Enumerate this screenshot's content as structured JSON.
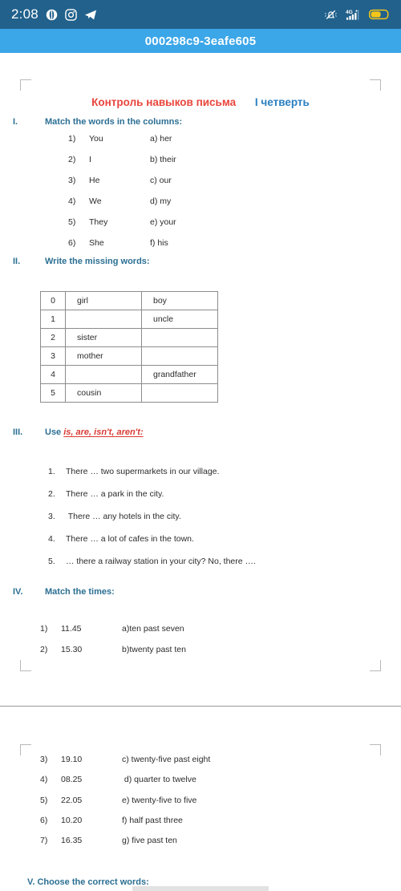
{
  "statusbar": {
    "time": "2:08",
    "left_icons": [
      "opera-browser-icon",
      "instagram-icon",
      "telegram-icon"
    ],
    "right_icons": [
      "bell-muted-icon",
      "signal-4g-plus-icon",
      "battery-icon"
    ],
    "background_color": "#21618c",
    "battery_color": "#f5c518"
  },
  "titlebar": {
    "title": "000298c9-3eafe605",
    "background_color": "#3ba6e8"
  },
  "document": {
    "heading_ru": "Контроль навыков письма",
    "heading_quarter": "I четверть",
    "heading_ru_color": "#e8453c",
    "heading_quarter_color": "#2a7fc1",
    "section_color": "#2b6f93",
    "sections": [
      {
        "num": "I.",
        "title": "Match the words in the columns:",
        "pairs": [
          {
            "n": "1)",
            "left": "You",
            "right": "a) her"
          },
          {
            "n": "2)",
            "left": "I",
            "right": "b) their"
          },
          {
            "n": "3)",
            "left": "He",
            "right": "c) our"
          },
          {
            "n": "4)",
            "left": "We",
            "right": "d) my"
          },
          {
            "n": "5)",
            "left": "They",
            "right": "e) your"
          },
          {
            "n": "6)",
            "left": "She",
            "right": "f) his"
          }
        ]
      },
      {
        "num": "II.",
        "title": "Write the missing  words:",
        "table": {
          "rows": [
            {
              "idx": "0",
              "c1": "girl",
              "c2": "boy"
            },
            {
              "idx": "1",
              "c1": "",
              "c2": "uncle"
            },
            {
              "idx": "2",
              "c1": "sister",
              "c2": ""
            },
            {
              "idx": "3",
              "c1": "mother",
              "c2": ""
            },
            {
              "idx": "4",
              "c1": "",
              "c2": "grandfather"
            },
            {
              "idx": "5",
              "c1": "cousin",
              "c2": ""
            }
          ]
        }
      },
      {
        "num": "III.",
        "title_plain": "Use ",
        "title_emph": "is, are, isn't, aren't:",
        "questions": [
          {
            "n": "1.",
            "text": "There … two supermarkets in our village."
          },
          {
            "n": "2.",
            "text": "There … a park in the city."
          },
          {
            "n": "3.",
            "text": " There …  any hotels in the city."
          },
          {
            "n": "4.",
            "text": "There … a lot of cafes in the town."
          },
          {
            "n": "5.",
            "text": "… there a railway station in your city? No, there …."
          }
        ]
      },
      {
        "num": "IV.",
        "title": "Match the times:",
        "pairs_top": [
          {
            "n": "1)",
            "left": "11.45",
            "right": "a)ten past seven"
          },
          {
            "n": "2)",
            "left": "15.30",
            "right": "b)twenty past ten"
          }
        ],
        "pairs_bottom": [
          {
            "n": "3)",
            "left": "19.10",
            "right": "c) twenty-five past eight"
          },
          {
            "n": "4)",
            "left": "08.25",
            "right": " d) quarter to twelve"
          },
          {
            "n": "5)",
            "left": "22.05",
            "right": "e) twenty-five to five"
          },
          {
            "n": "6)",
            "left": "10.20",
            "right": "f) half past three"
          },
          {
            "n": "7)",
            "left": "16.35",
            "right": "g) five past ten"
          }
        ]
      },
      {
        "num": "V.",
        "title": "Choose the correct words:"
      }
    ]
  }
}
